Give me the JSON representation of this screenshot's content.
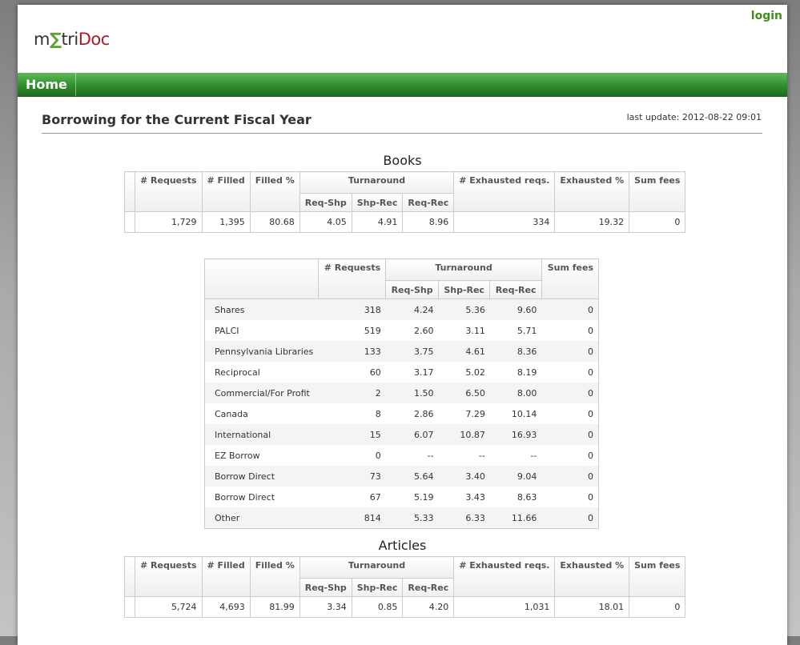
{
  "app": {
    "logo": {
      "pre": "m",
      "mid": "∑",
      "post1": "tri",
      "post2": "Doc"
    },
    "login_label": "login",
    "nav": {
      "home_label": "Home"
    }
  },
  "page": {
    "title": "Borrowing for the Current Fiscal Year",
    "last_update": "last update: 2012-08-22 09:01"
  },
  "books": {
    "heading": "Books",
    "headers": {
      "requests": "# Requests",
      "filled": "# Filled",
      "filled_pct": "Filled %",
      "turnaround": "Turnaround",
      "req_shp": "Req-Shp",
      "shp_rec": "Shp-Rec",
      "req_rec": "Req-Rec",
      "exhausted_reqs": "# Exhausted reqs.",
      "exhausted_pct": "Exhausted %",
      "sum_fees": "Sum fees"
    },
    "row": [
      "1,729",
      "1,395",
      "80.68",
      "4.05",
      "4.91",
      "8.96",
      "334",
      "19.32",
      "0"
    ]
  },
  "libraries": {
    "headers": {
      "requests": "# Requests",
      "turnaround": "Turnaround",
      "req_shp": "Req-Shp",
      "shp_rec": "Shp-Rec",
      "req_rec": "Req-Rec",
      "sum_fees": "Sum fees"
    },
    "rows": [
      [
        "Shares",
        "318",
        "4.24",
        "5.36",
        "9.60",
        "0"
      ],
      [
        "PALCI",
        "519",
        "2.60",
        "3.11",
        "5.71",
        "0"
      ],
      [
        "Pennsylvania Libraries",
        "133",
        "3.75",
        "4.61",
        "8.36",
        "0"
      ],
      [
        "Reciprocal",
        "60",
        "3.17",
        "5.02",
        "8.19",
        "0"
      ],
      [
        "Commercial/For Profit",
        "2",
        "1.50",
        "6.50",
        "8.00",
        "0"
      ],
      [
        "Canada",
        "8",
        "2.86",
        "7.29",
        "10.14",
        "0"
      ],
      [
        "International",
        "15",
        "6.07",
        "10.87",
        "16.93",
        "0"
      ],
      [
        "EZ Borrow",
        "0",
        "--",
        "--",
        "--",
        "0"
      ],
      [
        "Borrow Direct",
        "73",
        "5.64",
        "3.40",
        "9.04",
        "0"
      ],
      [
        "Borrow Direct",
        "67",
        "5.19",
        "3.43",
        "8.63",
        "0"
      ],
      [
        "Other",
        "814",
        "5.33",
        "6.33",
        "11.66",
        "0"
      ]
    ]
  },
  "articles": {
    "heading": "Articles",
    "headers": {
      "requests": "# Requests",
      "filled": "# Filled",
      "filled_pct": "Filled %",
      "turnaround": "Turnaround",
      "req_shp": "Req-Shp",
      "shp_rec": "Shp-Rec",
      "req_rec": "Req-Rec",
      "exhausted_reqs": "# Exhausted reqs.",
      "exhausted_pct": "Exhausted %",
      "sum_fees": "Sum fees"
    },
    "row": [
      "5,724",
      "4,693",
      "81.99",
      "3.34",
      "0.85",
      "4.20",
      "1,031",
      "18.01",
      "0"
    ]
  }
}
